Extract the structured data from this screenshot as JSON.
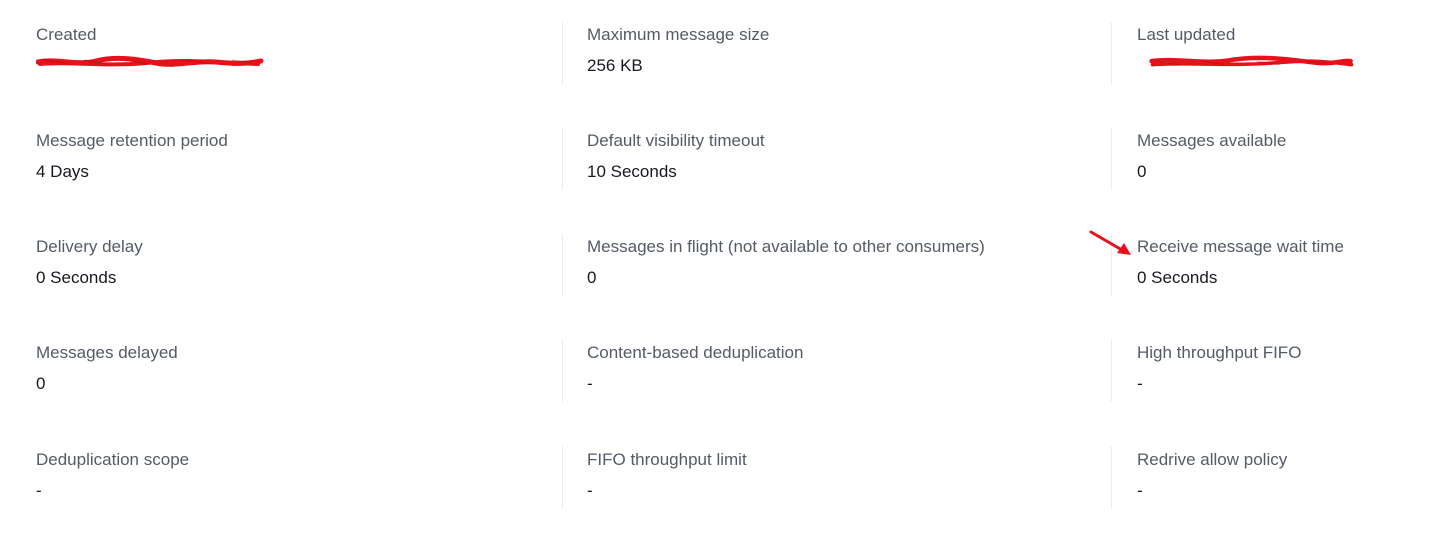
{
  "details": {
    "created": {
      "label": "Created",
      "value_redacted": true
    },
    "max_message_size": {
      "label": "Maximum message size",
      "value": "256 KB"
    },
    "last_updated": {
      "label": "Last updated",
      "value_redacted": true
    },
    "retention_period": {
      "label": "Message retention period",
      "value": "4 Days"
    },
    "visibility_timeout": {
      "label": "Default visibility timeout",
      "value": "10 Seconds"
    },
    "messages_available": {
      "label": "Messages available",
      "value": "0"
    },
    "delivery_delay": {
      "label": "Delivery delay",
      "value": "0 Seconds"
    },
    "messages_in_flight": {
      "label": "Messages in flight (not available to other consumers)",
      "value": "0"
    },
    "receive_wait_time": {
      "label": "Receive message wait time",
      "value": "0 Seconds"
    },
    "messages_delayed": {
      "label": "Messages delayed",
      "value": "0"
    },
    "content_dedup": {
      "label": "Content-based deduplication",
      "value": "-"
    },
    "high_throughput_fifo": {
      "label": "High throughput FIFO",
      "value": "-"
    },
    "dedup_scope": {
      "label": "Deduplication scope",
      "value": "-"
    },
    "fifo_throughput_limit": {
      "label": "FIFO throughput limit",
      "value": "-"
    },
    "redrive_allow_policy": {
      "label": "Redrive allow policy",
      "value": "-"
    }
  },
  "colors": {
    "label": "#545b64",
    "value": "#16191f",
    "divider": "#eaeded",
    "redaction": "#e8101a",
    "annotation_arrow": "#e8101a"
  },
  "icons": {
    "annotation": "red-arrow-icon"
  }
}
